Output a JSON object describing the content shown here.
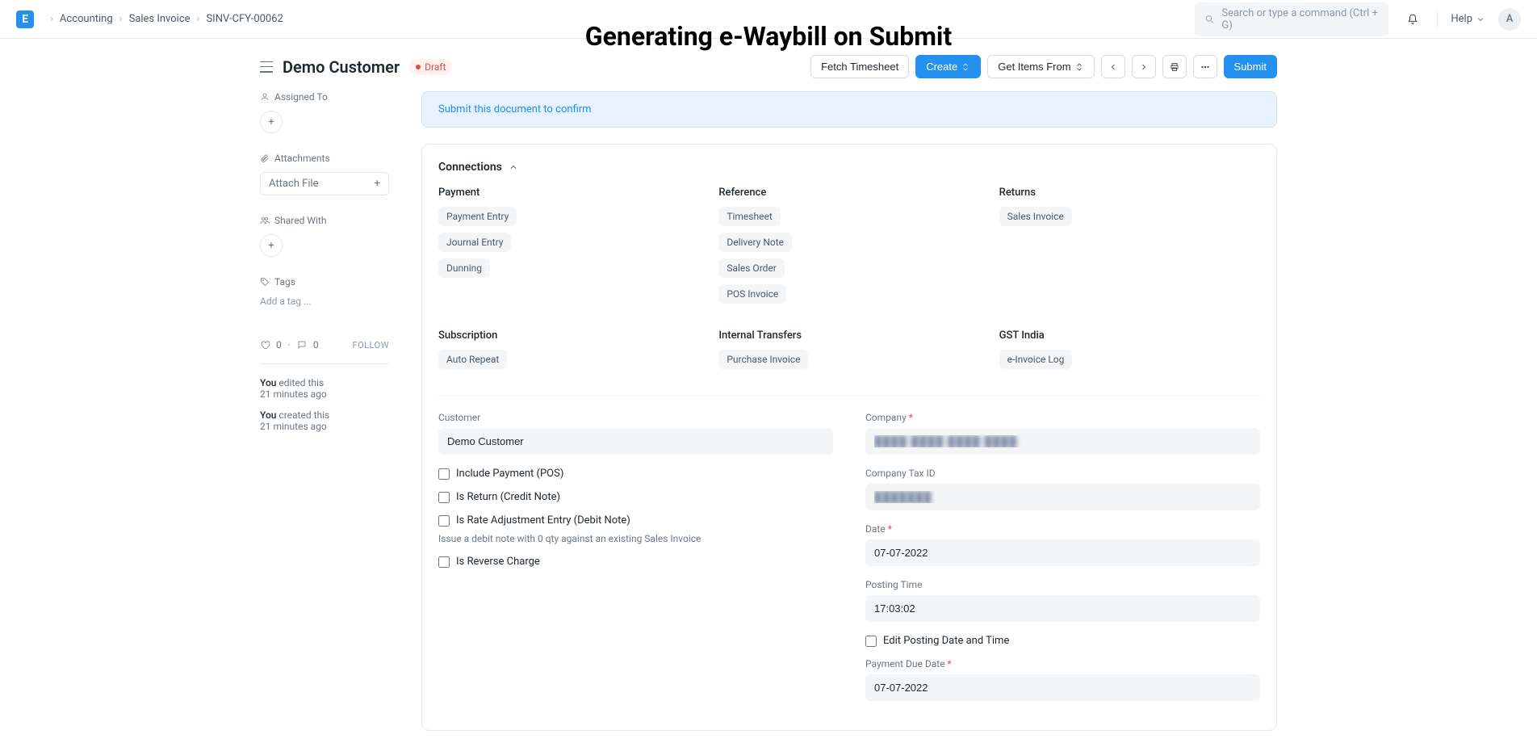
{
  "overlay_title": "Generating e-Waybill on Submit",
  "breadcrumb": {
    "logo": "E",
    "items": [
      "Accounting",
      "Sales Invoice",
      "SINV-CFY-00062"
    ]
  },
  "topbar": {
    "search_placeholder": "Search or type a command (Ctrl + G)",
    "help_label": "Help",
    "avatar_initial": "A"
  },
  "header": {
    "title": "Demo Customer",
    "status": "Draft",
    "actions": {
      "fetch_timesheet": "Fetch Timesheet",
      "create": "Create",
      "get_items_from": "Get Items From",
      "submit": "Submit"
    }
  },
  "sidebar": {
    "assigned_to": "Assigned To",
    "attachments": "Attachments",
    "attach_file": "Attach File",
    "shared_with": "Shared With",
    "tags": "Tags",
    "add_tag": "Add a tag ...",
    "likes": "0",
    "comments": "0",
    "follow": "FOLLOW",
    "activity": [
      {
        "who": "You",
        "action": "edited this",
        "when": "21 minutes ago"
      },
      {
        "who": "You",
        "action": "created this",
        "when": "21 minutes ago"
      }
    ]
  },
  "banner": "Submit this document to confirm",
  "connections": {
    "title": "Connections",
    "groups": [
      {
        "name": "Payment",
        "items": [
          "Payment Entry",
          "Journal Entry",
          "Dunning"
        ]
      },
      {
        "name": "Reference",
        "items": [
          "Timesheet",
          "Delivery Note",
          "Sales Order",
          "POS Invoice"
        ]
      },
      {
        "name": "Returns",
        "items": [
          "Sales Invoice"
        ]
      },
      {
        "name": "Subscription",
        "items": [
          "Auto Repeat"
        ]
      },
      {
        "name": "Internal Transfers",
        "items": [
          "Purchase Invoice"
        ]
      },
      {
        "name": "GST India",
        "items": [
          "e-Invoice Log"
        ]
      }
    ]
  },
  "form": {
    "customer_label": "Customer",
    "customer_value": "Demo Customer",
    "include_payment": "Include Payment (POS)",
    "is_return": "Is Return (Credit Note)",
    "is_rate_adj": "Is Rate Adjustment Entry (Debit Note)",
    "rate_adj_help": "Issue a debit note with 0 qty against an existing Sales Invoice",
    "is_reverse": "Is Reverse Charge",
    "company_label": "Company",
    "company_value": "████ ████ ████ ████",
    "company_tax_label": "Company Tax ID",
    "company_tax_value": "███████",
    "date_label": "Date",
    "date_value": "07-07-2022",
    "posting_time_label": "Posting Time",
    "posting_time_value": "17:03:02",
    "edit_posting": "Edit Posting Date and Time",
    "payment_due_label": "Payment Due Date",
    "payment_due_value": "07-07-2022"
  }
}
